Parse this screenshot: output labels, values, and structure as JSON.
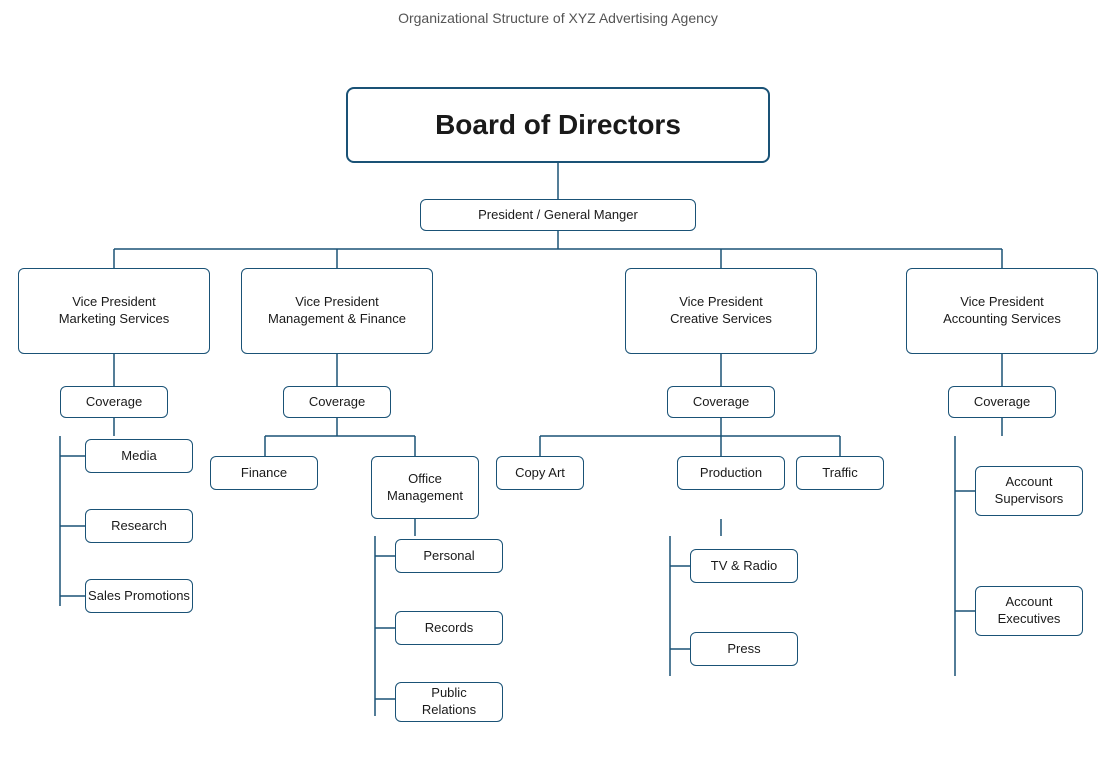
{
  "page": {
    "title": "Organizational Structure of XYZ Advertising Agency"
  },
  "nodes": {
    "board": "Board of Directors",
    "president": "President / General Manger",
    "vp_marketing": "Vice President\nMarketing Services",
    "vp_management": "Vice President\nManagement & Finance",
    "vp_creative": "Vice President\nCreative Services",
    "vp_accounting": "Vice President\nAccounting Services",
    "coverage_marketing": "Coverage",
    "coverage_management": "Coverage",
    "coverage_creative": "Coverage",
    "coverage_accounting": "Coverage",
    "media": "Media",
    "research": "Research",
    "sales_promotions": "Sales Promotions",
    "finance": "Finance",
    "office_management": "Office\nManagement",
    "personal": "Personal",
    "records": "Records",
    "public_relations": "Public\nRelations",
    "copy_art": "Copy Art",
    "production": "Production",
    "traffic": "Traffic",
    "tv_radio": "TV & Radio",
    "press": "Press",
    "account_supervisors": "Account\nSupervisors",
    "account_executives": "Account\nExecutives"
  }
}
